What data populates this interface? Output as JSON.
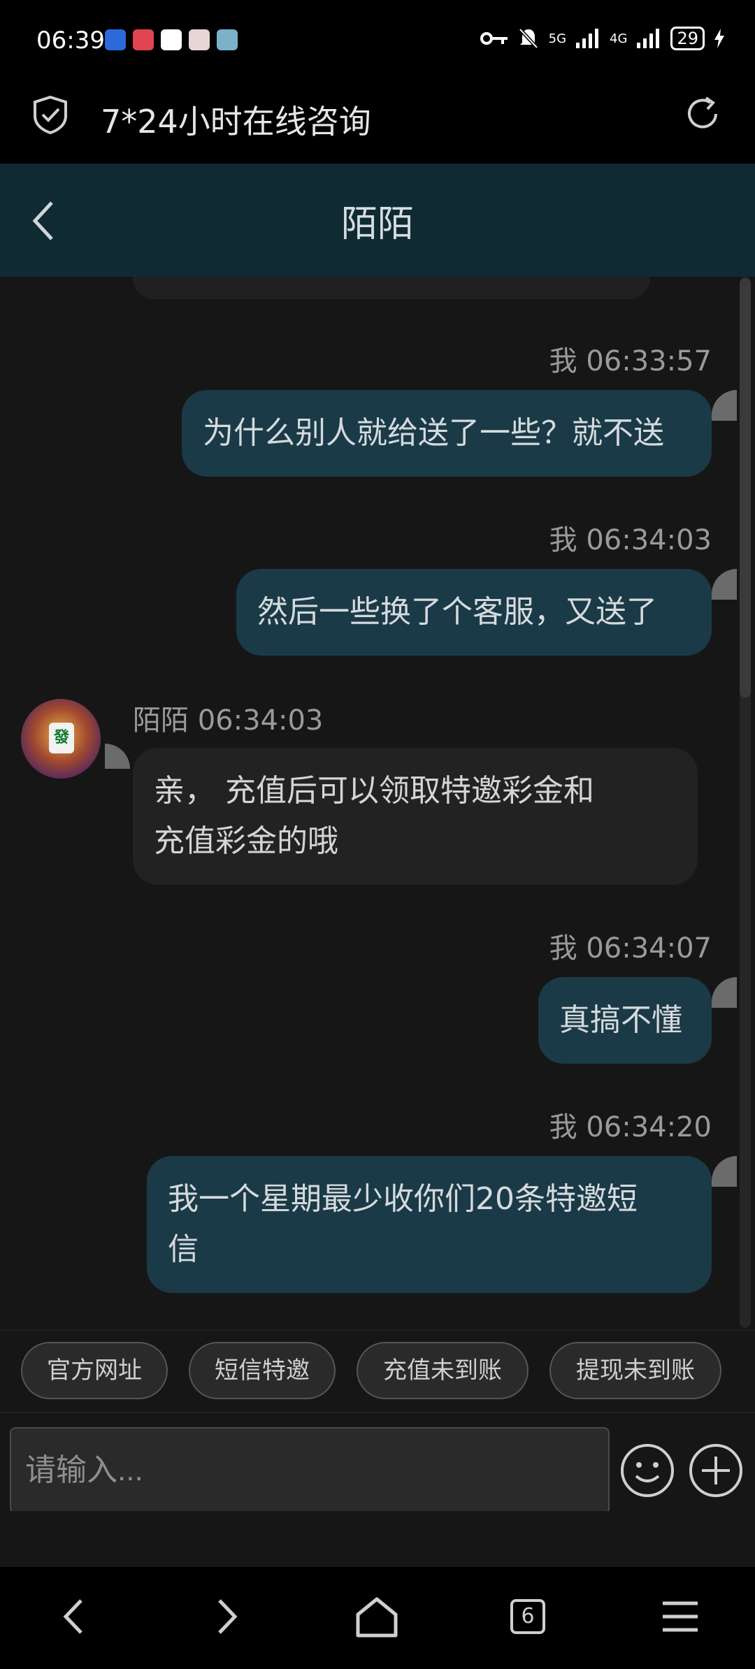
{
  "status_bar": {
    "time": "06:39",
    "network_1": "5G",
    "network_2": "4G",
    "battery": "29"
  },
  "browser": {
    "title": "7*24小时在线咨询"
  },
  "chat": {
    "title": "陌陌",
    "messages": [
      {
        "sender": "me",
        "meta": "我 06:33:57",
        "text": "为什么别人就给送了一些？就不送"
      },
      {
        "sender": "me",
        "meta": "我 06:34:03",
        "text": "然后一些换了个客服，又送了"
      },
      {
        "sender": "other",
        "meta": "陌陌 06:34:03",
        "text_line1": "亲， 充值后可以领取特邀彩金和",
        "text_line2": "充值彩金的哦"
      },
      {
        "sender": "me",
        "meta": "我 06:34:07",
        "text": "真搞不懂"
      },
      {
        "sender": "me",
        "meta": "我 06:34:20",
        "text_line1": "我一个星期最少收你们20条特邀短",
        "text_line2": "信"
      }
    ]
  },
  "quick_replies": [
    "官方网址",
    "短信特邀",
    "充值未到账",
    "提现未到账"
  ],
  "input": {
    "placeholder": "请输入..."
  },
  "nav": {
    "tab_count": "6"
  },
  "colors": {
    "header_bg": "#0f2a33",
    "my_bubble": "#1b3a47",
    "other_bubble": "#222222"
  }
}
